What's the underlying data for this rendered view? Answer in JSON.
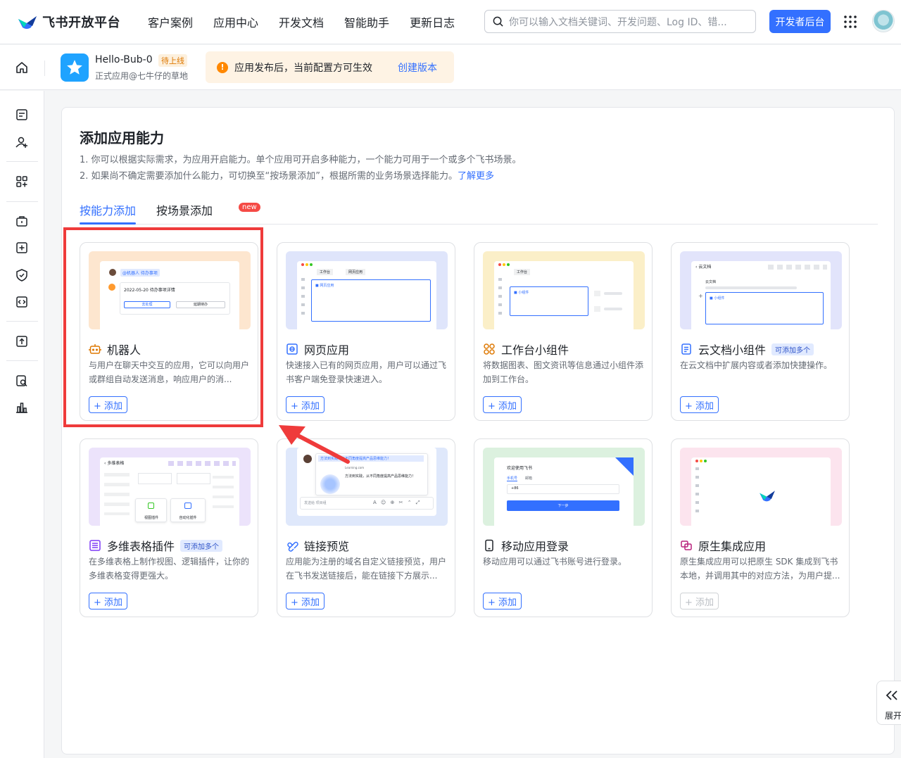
{
  "brand": {
    "name": "飞书开放平台"
  },
  "nav": [
    "客户案例",
    "应用中心",
    "开发文档",
    "智能助手",
    "更新日志"
  ],
  "search": {
    "placeholder": "你可以输入文档关键词、开发问题、Log ID、错..."
  },
  "header": {
    "dev_button": "开发者后台"
  },
  "app": {
    "name": "Hello-Bub-0",
    "status": "待上线",
    "subtitle": "正式应用@七牛仔的草地"
  },
  "notice": {
    "text": "应用发布后，当前配置方可生效",
    "link": "创建版本"
  },
  "sidebar": {
    "icons": [
      "document-icon",
      "user-add-icon",
      "apps-grid-icon",
      "briefcase-icon",
      "add-box-icon",
      "shield-icon",
      "code-icon",
      "upload-icon",
      "search-doc-icon",
      "chart-icon"
    ]
  },
  "page": {
    "title": "添加应用能力",
    "desc1": "1. 你可以根据实际需求，为应用开启能力。单个应用可开启多种能力，一个能力可用于一个或多个飞书场景。",
    "desc2": "2. 如果尚不确定需要添加什么能力，可切换至“按场景添加”，根据所需的业务场景选择能力。",
    "learn_more": "了解更多",
    "tabs": [
      "按能力添加",
      "按场景添加"
    ],
    "new_badge": "new"
  },
  "add_label": "+ 添加",
  "cards": [
    {
      "title": "机器人",
      "desc": "与用户在聊天中交互的应用，它可以向用户或群组自动发送消息，响应用户的消...",
      "icon": "robot-icon",
      "badge": "",
      "thumb_color": "#fde6cf",
      "enabled": true,
      "mock": {
        "tag": "@机器人 待办事项",
        "line": "2022-05-20 待办事项详情",
        "btn1": "去处理",
        "btn2": "延期待办"
      }
    },
    {
      "title": "网页应用",
      "desc": "快速接入已有的网页应用，用户可以通过飞书客户端免登录快速进入。",
      "icon": "web-app-icon",
      "badge": "",
      "thumb_color": "#dfe5fb",
      "enabled": true,
      "mock": {
        "tab1": "工作台",
        "tab2": "网页应用",
        "label": "网页应用"
      }
    },
    {
      "title": "工作台小组件",
      "desc": "将数据图表、图文资讯等信息通过小组件添加到工作台。",
      "icon": "widget-grid-icon",
      "badge": "",
      "thumb_color": "#fbefc8",
      "enabled": true,
      "mock": {
        "tab1": "工作台",
        "label": "小组件"
      }
    },
    {
      "title": "云文档小组件",
      "desc": "在云文档中扩展内容或者添加快捷操作。",
      "icon": "cloud-doc-icon",
      "badge": "可添加多个",
      "thumb_color": "#e2e4fb",
      "enabled": true,
      "mock": {
        "tab1": "云文档",
        "tab2": "云文档",
        "label": "小组件"
      }
    },
    {
      "title": "多维表格插件",
      "desc": "在多维表格上制作视图、逻辑插件，让你的多维表格变得更强大。",
      "icon": "bitable-icon",
      "badge": "可添加多个",
      "thumb_color": "#ece3fb",
      "enabled": true,
      "mock": {
        "tab1": "多维表格",
        "btn1": "视图插件",
        "btn2": "自动化插件"
      }
    },
    {
      "title": "链接预览",
      "desc": "应用能为注册的域名自定义链接预览，用户在飞书发送链接后，能在链接下方展示...",
      "icon": "link-icon",
      "badge": "",
      "thumb_color": "#dfe8fb",
      "enabled": true,
      "mock": {
        "tag": "方法到实践：从不同角度提高产品思维能力！",
        "domain": "Learning.com",
        "line": "方法到实践，从不同角度提高产品思维能力！",
        "input": "发送给 项目组"
      }
    },
    {
      "title": "移动应用登录",
      "desc": "移动应用可以通过飞书账号进行登录。",
      "icon": "mobile-icon",
      "badge": "",
      "thumb_color": "#dcf1df",
      "enabled": true,
      "mock": {
        "title": "欢迎使用飞书",
        "tab1": "手机号",
        "tab2": "邮箱",
        "code": "+86",
        "btn": "下一步"
      }
    },
    {
      "title": "原生集成应用",
      "desc": "原生集成应用可以把原生 SDK 集成到飞书本地，并调用其中的对应方法，为用户提...",
      "icon": "native-app-icon",
      "badge": "",
      "thumb_color": "#fce4ee",
      "enabled": false,
      "mock": {}
    }
  ],
  "expand": {
    "label": "展开"
  }
}
